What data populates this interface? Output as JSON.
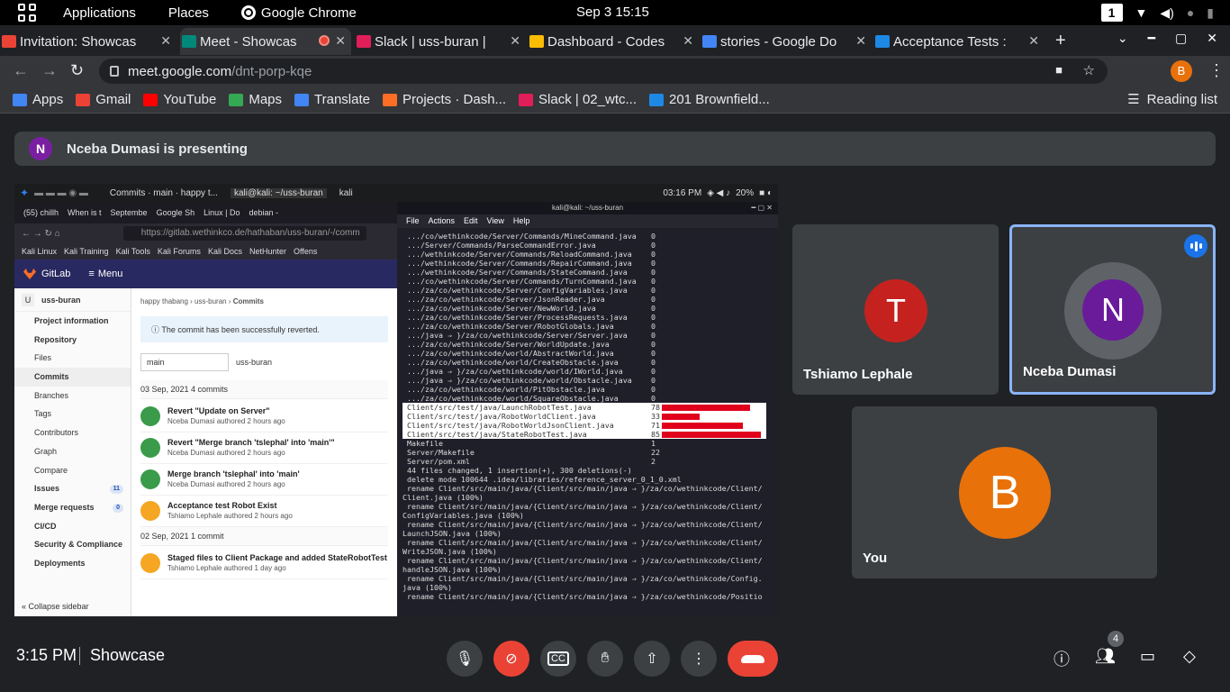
{
  "topbar": {
    "applications": "Applications",
    "places": "Places",
    "app": "Google Chrome",
    "clock": "Sep 3  15:15",
    "workspace": "1"
  },
  "tabs": [
    {
      "label": "Invitation: Showcas",
      "favicon_color": "#ea4335"
    },
    {
      "label": "Meet - Showcas",
      "favicon_color": "#00897b"
    },
    {
      "label": "Slack | uss-buran |",
      "favicon_color": "#e01e5a"
    },
    {
      "label": "Dashboard - Codes",
      "favicon_color": "#fbbc04"
    },
    {
      "label": "stories - Google Do",
      "favicon_color": "#4285f4"
    },
    {
      "label": "Acceptance Tests :",
      "favicon_color": "#1e88e5"
    }
  ],
  "omnibox": {
    "host": "meet.google.com",
    "path": "/dnt-porp-kqe"
  },
  "profile_initial": "B",
  "bookmarks": [
    {
      "label": "Apps",
      "color": "#4285f4"
    },
    {
      "label": "Gmail",
      "color": "#ea4335"
    },
    {
      "label": "YouTube",
      "color": "#ff0000"
    },
    {
      "label": "Maps",
      "color": "#34a853"
    },
    {
      "label": "Translate",
      "color": "#4285f4"
    },
    {
      "label": "Projects · Dash...",
      "color": "#fc6d26"
    },
    {
      "label": "Slack | 02_wtc...",
      "color": "#e01e5a"
    },
    {
      "label": "201 Brownfield...",
      "color": "#1e88e5"
    }
  ],
  "reading_list": "Reading list",
  "banner": {
    "initial": "N",
    "text": "Nceba Dumasi is presenting"
  },
  "kali": {
    "tasks": [
      "Commits · main · happy t...",
      "kali@kali: ~/uss-buran",
      "kali"
    ],
    "time": "03:16 PM",
    "battery": "20%"
  },
  "firefox": {
    "tabs": [
      "(55) chillh",
      "When is t",
      "Septembe",
      "Google Sh",
      "Linux | Do",
      "debian -"
    ],
    "url": "https://gitlab.wethinkco.de/hathaban/uss-buran/-/comm",
    "bookmarks": [
      "Kali Linux",
      "Kali Training",
      "Kali Tools",
      "Kali Forums",
      "Kali Docs",
      "NetHunter",
      "Offens"
    ]
  },
  "gitlab": {
    "brand": "GitLab",
    "menu": "Menu",
    "project_initial": "U",
    "project": "uss-buran",
    "sidebar": [
      {
        "label": "Project information",
        "type": "bold"
      },
      {
        "label": "Repository",
        "type": "bold"
      },
      {
        "label": "Files",
        "type": "sub"
      },
      {
        "label": "Commits",
        "type": "active"
      },
      {
        "label": "Branches",
        "type": "sub"
      },
      {
        "label": "Tags",
        "type": "sub"
      },
      {
        "label": "Contributors",
        "type": "sub"
      },
      {
        "label": "Graph",
        "type": "sub"
      },
      {
        "label": "Compare",
        "type": "sub"
      },
      {
        "label": "Issues",
        "type": "bold",
        "count": "11"
      },
      {
        "label": "Merge requests",
        "type": "bold",
        "count": "0"
      },
      {
        "label": "CI/CD",
        "type": "bold"
      },
      {
        "label": "Security & Compliance",
        "type": "bold"
      },
      {
        "label": "Deployments",
        "type": "bold"
      }
    ],
    "collapse": "Collapse sidebar",
    "breadcrumb": [
      "happy thabang",
      "uss-buran",
      "Commits"
    ],
    "alert": "The commit has been successfully reverted.",
    "branch": "main",
    "repo": "uss-buran",
    "groups": [
      {
        "day": "03 Sep, 2021 4 commits",
        "commits": [
          {
            "title": "Revert \"Update on Server\"",
            "meta": "Nceba Dumasi authored 2 hours ago",
            "color": "#3a9b4a"
          },
          {
            "title": "Revert \"Merge branch 'tslephal' into 'main'\"",
            "meta": "Nceba Dumasi authored 2 hours ago",
            "color": "#3a9b4a"
          },
          {
            "title": "Merge branch 'tslephal' into 'main'",
            "meta": "Nceba Dumasi authored 2 hours ago",
            "color": "#3a9b4a"
          },
          {
            "title": "Acceptance test Robot Exist",
            "meta": "Tshiamo Lephale authored 2 hours ago",
            "color": "#f5a623"
          }
        ]
      },
      {
        "day": "02 Sep, 2021 1 commit",
        "commits": [
          {
            "title": "Staged files to Client Package and added StateRobotTest",
            "meta": "Tshiamo Lephale authored 1 day ago",
            "color": "#f5a623"
          }
        ]
      }
    ]
  },
  "terminal": {
    "title": "kali@kali: ~/uss-buran",
    "menu": [
      "File",
      "Actions",
      "Edit",
      "View",
      "Help"
    ],
    "lines": [
      {
        "text": " .../co/wethinkcode/Server/Commands/MineCommand.java    ",
        "n": "0"
      },
      {
        "text": " .../Server/Commands/ParseCommandError.java            ",
        "n": "0"
      },
      {
        "text": " .../wethinkcode/Server/Commands/ReloadCommand.java     ",
        "n": "0"
      },
      {
        "text": " .../wethinkcode/Server/Commands/RepairCommand.java     ",
        "n": "0"
      },
      {
        "text": " .../wethinkcode/Server/Commands/StateCommand.java      ",
        "n": "0"
      },
      {
        "text": " .../co/wethinkcode/Server/Commands/TurnCommand.java    ",
        "n": "0"
      },
      {
        "text": " .../za/co/wethinkcode/Server/ConfigVariables.java      ",
        "n": "0"
      },
      {
        "text": " .../za/co/wethinkcode/Server/JsonReader.java           ",
        "n": "0"
      },
      {
        "text": " .../za/co/wethinkcode/Server/NewWorld.java             ",
        "n": "0"
      },
      {
        "text": " .../za/co/wethinkcode/Server/ProcessRequests.java      ",
        "n": "0"
      },
      {
        "text": " .../za/co/wethinkcode/Server/RobotGlobals.java         ",
        "n": "0"
      },
      {
        "text": " .../java ⇒ }/za/co/wethinkcode/Server/Server.java      ",
        "n": "0"
      },
      {
        "text": " .../za/co/wethinkcode/Server/WorldUpdate.java          ",
        "n": "0"
      },
      {
        "text": " .../za/co/wethinkcode/world/AbstractWorld.java         ",
        "n": "0"
      },
      {
        "text": " .../za/co/wethinkcode/world/CreateObstacle.java        ",
        "n": "0"
      },
      {
        "text": " .../java ⇒ }/za/co/wethinkcode/world/IWorld.java       ",
        "n": "0"
      },
      {
        "text": " .../java ⇒ }/za/co/wethinkcode/world/Obstacle.java     ",
        "n": "0"
      },
      {
        "text": " .../za/co/wethinkcode/world/PitObstacle.java           ",
        "n": "0"
      },
      {
        "text": " .../za/co/wethinkcode/world/SquareObstacle.java        ",
        "n": "0"
      },
      {
        "text": " Client/src/test/java/LaunchRobotTest.java              ",
        "n": "78",
        "hl": true,
        "bar": 98
      },
      {
        "text": " Client/src/test/java/RobotWorldClient.java             ",
        "n": "33",
        "hl": true,
        "bar": 42
      },
      {
        "text": " Client/src/test/java/RobotWorldJsonClient.java         ",
        "n": "71",
        "hl": true,
        "bar": 90
      },
      {
        "text": " Client/src/test/java/StateRobotTest.java               ",
        "n": "85",
        "hl": true,
        "bar": 110
      },
      {
        "text": " Makefile                                               ",
        "n": "1"
      },
      {
        "text": " Server/Makefile                                        ",
        "n": "22"
      },
      {
        "text": " Server/pom.xml                                         ",
        "n": "2"
      },
      {
        "text": " 44 files changed, 1 insertion(+), 300 deletions(-)"
      },
      {
        "text": " delete mode 100644 .idea/libraries/reference_server_0_1_0.xml"
      },
      {
        "text": " rename Client/src/main/java/{Client/src/main/java ⇒ }/za/co/wethinkcode/Client/"
      },
      {
        "text": "Client.java (100%)"
      },
      {
        "text": " rename Client/src/main/java/{Client/src/main/java ⇒ }/za/co/wethinkcode/Client/"
      },
      {
        "text": "ConfigVariables.java (100%)"
      },
      {
        "text": " rename Client/src/main/java/{Client/src/main/java ⇒ }/za/co/wethinkcode/Client/"
      },
      {
        "text": "LaunchJSON.java (100%)"
      },
      {
        "text": " rename Client/src/main/java/{Client/src/main/java ⇒ }/za/co/wethinkcode/Client/"
      },
      {
        "text": "WriteJSON.java (100%)"
      },
      {
        "text": " rename Client/src/main/java/{Client/src/main/java ⇒ }/za/co/wethinkcode/Client/"
      },
      {
        "text": "handleJSON.java (100%)"
      },
      {
        "text": " rename Client/src/main/java/{Client/src/main/java ⇒ }/za/co/wethinkcode/Config."
      },
      {
        "text": "java (100%)"
      },
      {
        "text": " rename Client/src/main/java/{Client/src/main/java ⇒ }/za/co/wethinkcode/Positio"
      }
    ]
  },
  "participants": [
    {
      "initial": "T",
      "name": "Tshiamo Lephale",
      "color": "#c5221f"
    },
    {
      "initial": "N",
      "name": "Nceba Dumasi",
      "color": "#6a1b9a",
      "speaking": true
    },
    {
      "initial": "B",
      "name": "You",
      "color": "#e8710a"
    }
  ],
  "meeting": {
    "time": "3:15 PM",
    "name": "Showcase",
    "people_count": "4"
  }
}
